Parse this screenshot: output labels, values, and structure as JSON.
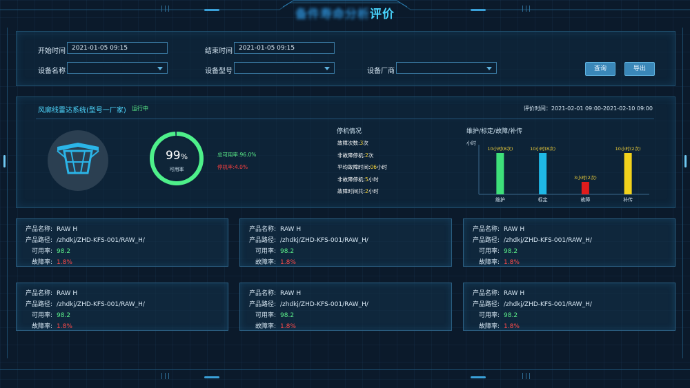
{
  "title": {
    "blurred": "备件寿命分析",
    "visible": "评价"
  },
  "filters": {
    "start_time_label": "开始时间",
    "start_time_value": "2021-01-05  09:15",
    "end_time_label": "结束时间",
    "end_time_value": "2021-01-05  09:15",
    "device_name_label": "设备名称",
    "device_name_value": "",
    "device_model_label": "设备型号",
    "device_model_value": "",
    "vendor_label": "设备厂商",
    "vendor_value": "",
    "query_btn": "查询",
    "export_btn": "导出"
  },
  "system": {
    "name": "风廓线雷达系统(型号一厂家)",
    "status": "运行中",
    "eval_time": "评价时间：2021-02-01  09:00-2021-02-10  09:00",
    "availability_value": "99",
    "availability_unit": "%",
    "availability_label": "可用率",
    "availability_fraction": 0.99,
    "total_rate": "总可用率:96.0%",
    "downtime_rate": "停机率:4.0%"
  },
  "downtime": {
    "title": "停机情况",
    "rows": [
      {
        "k": "故障次数:",
        "v": "3",
        "u": "次"
      },
      {
        "k": "非故障停机:",
        "v": "2",
        "u": "次"
      },
      {
        "k": "平均故障时间:",
        "v": "06",
        "u": "小时"
      },
      {
        "k": "非故障停机:",
        "v": "5",
        "u": "小时"
      },
      {
        "k": "故障时间共:",
        "v": "2",
        "u": "小时"
      }
    ]
  },
  "maint": {
    "title": "维护/标定/故障/补传",
    "y_unit": "小时"
  },
  "chart_data": {
    "type": "bar",
    "categories": [
      "维护",
      "标定",
      "故障",
      "补传"
    ],
    "values": [
      10,
      10,
      3,
      10
    ],
    "data_labels": [
      "10小时(8次)",
      "10小时(8次)",
      "3小时(2次)",
      "10小时(2次)"
    ],
    "colors": [
      "#3ee07a",
      "#1fb8e6",
      "#e01c1c",
      "#f2d21c"
    ],
    "ylabel": "小时",
    "ylim": [
      0,
      12
    ]
  },
  "cards": [
    {
      "name_k": "产品名称:",
      "name_v": "RAW H",
      "path_k": "产品路径:",
      "path_v": "/zhdkj/ZHD-KFS-001/RAW_H/",
      "avail_k": "可用率:",
      "avail_v": "98.2",
      "fail_k": "故障率:",
      "fail_v": "1.8%"
    },
    {
      "name_k": "产品名称:",
      "name_v": "RAW H",
      "path_k": "产品路径:",
      "path_v": "/zhdkj/ZHD-KFS-001/RAW_H/",
      "avail_k": "可用率:",
      "avail_v": "98.2",
      "fail_k": "故障率:",
      "fail_v": "1.8%"
    },
    {
      "name_k": "产品名称:",
      "name_v": "RAW H",
      "path_k": "产品路径:",
      "path_v": "/zhdkj/ZHD-KFS-001/RAW_H/",
      "avail_k": "可用率:",
      "avail_v": "98.2",
      "fail_k": "故障率:",
      "fail_v": "1.8%"
    },
    {
      "name_k": "产品名称:",
      "name_v": "RAW H",
      "path_k": "产品路径:",
      "path_v": "/zhdkj/ZHD-KFS-001/RAW_H/",
      "avail_k": "可用率:",
      "avail_v": "98.2",
      "fail_k": "故障率:",
      "fail_v": "1.8%"
    },
    {
      "name_k": "产品名称:",
      "name_v": "RAW H",
      "path_k": "产品路径:",
      "path_v": "/zhdkj/ZHD-KFS-001/RAW_H/",
      "avail_k": "可用率:",
      "avail_v": "98.2",
      "fail_k": "故障率:",
      "fail_v": "1.8%"
    },
    {
      "name_k": "产品名称:",
      "name_v": "RAW H",
      "path_k": "产品路径:",
      "path_v": "/zhdkj/ZHD-KFS-001/RAW_H/",
      "avail_k": "可用率:",
      "avail_v": "98.2",
      "fail_k": "故障率:",
      "fail_v": "1.8%"
    }
  ],
  "icons": {
    "radar": "radar-antenna-icon",
    "caret": "chevron-down-icon"
  }
}
